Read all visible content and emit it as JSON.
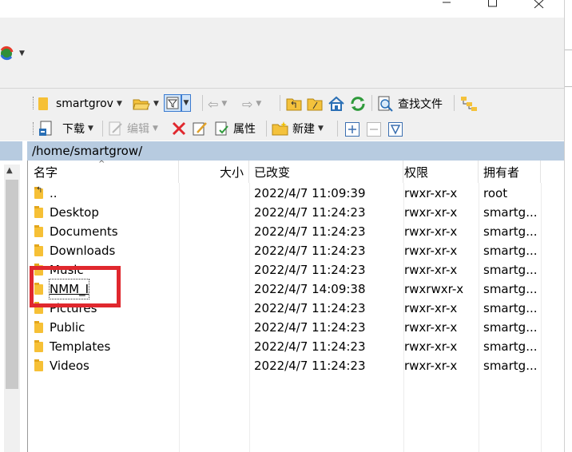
{
  "window": {
    "controls": [
      "minimize-icon",
      "maximize-icon",
      "close-icon"
    ]
  },
  "toolbar1": {
    "location": "smartgrov",
    "find_label": "查找文件"
  },
  "toolbar2": {
    "download_label": "下载",
    "edit_label": "编辑",
    "properties_label": "属性",
    "new_label": "新建"
  },
  "path": "/home/smartgrow/",
  "columns": {
    "name": "名字",
    "size": "大小",
    "modified": "已改变",
    "permissions": "权限",
    "owner": "拥有者"
  },
  "rows": [
    {
      "name": "..",
      "modified": "2022/4/7 11:09:39",
      "permissions": "rwxr-xr-x",
      "owner": "root",
      "icon": "parent-folder-icon"
    },
    {
      "name": "Desktop",
      "modified": "2022/4/7 11:24:23",
      "permissions": "rwxr-xr-x",
      "owner": "smartg...",
      "icon": "folder-icon"
    },
    {
      "name": "Documents",
      "modified": "2022/4/7 11:24:23",
      "permissions": "rwxr-xr-x",
      "owner": "smartg...",
      "icon": "folder-icon"
    },
    {
      "name": "Downloads",
      "modified": "2022/4/7 11:24:23",
      "permissions": "rwxr-xr-x",
      "owner": "smartg...",
      "icon": "folder-icon"
    },
    {
      "name": "Music",
      "modified": "2022/4/7 11:24:23",
      "permissions": "rwxr-xr-x",
      "owner": "smartg...",
      "icon": "folder-icon"
    },
    {
      "name": "NMM_I",
      "modified": "2022/4/7 14:09:38",
      "permissions": "rwxrwxr-x",
      "owner": "smartg...",
      "icon": "folder-icon"
    },
    {
      "name": "Pictures",
      "modified": "2022/4/7 11:24:23",
      "permissions": "rwxr-xr-x",
      "owner": "smartg...",
      "icon": "folder-icon"
    },
    {
      "name": "Public",
      "modified": "2022/4/7 11:24:23",
      "permissions": "rwxr-xr-x",
      "owner": "smartg...",
      "icon": "folder-icon"
    },
    {
      "name": "Templates",
      "modified": "2022/4/7 11:24:23",
      "permissions": "rwxr-xr-x",
      "owner": "smartg...",
      "icon": "folder-icon"
    },
    {
      "name": "Videos",
      "modified": "2022/4/7 11:24:23",
      "permissions": "rwxr-xr-x",
      "owner": "smartg...",
      "icon": "folder-icon"
    }
  ],
  "colors": {
    "path_bar": "#b7cbe0",
    "highlight": "#e0282e",
    "folder": "#f6c036"
  }
}
